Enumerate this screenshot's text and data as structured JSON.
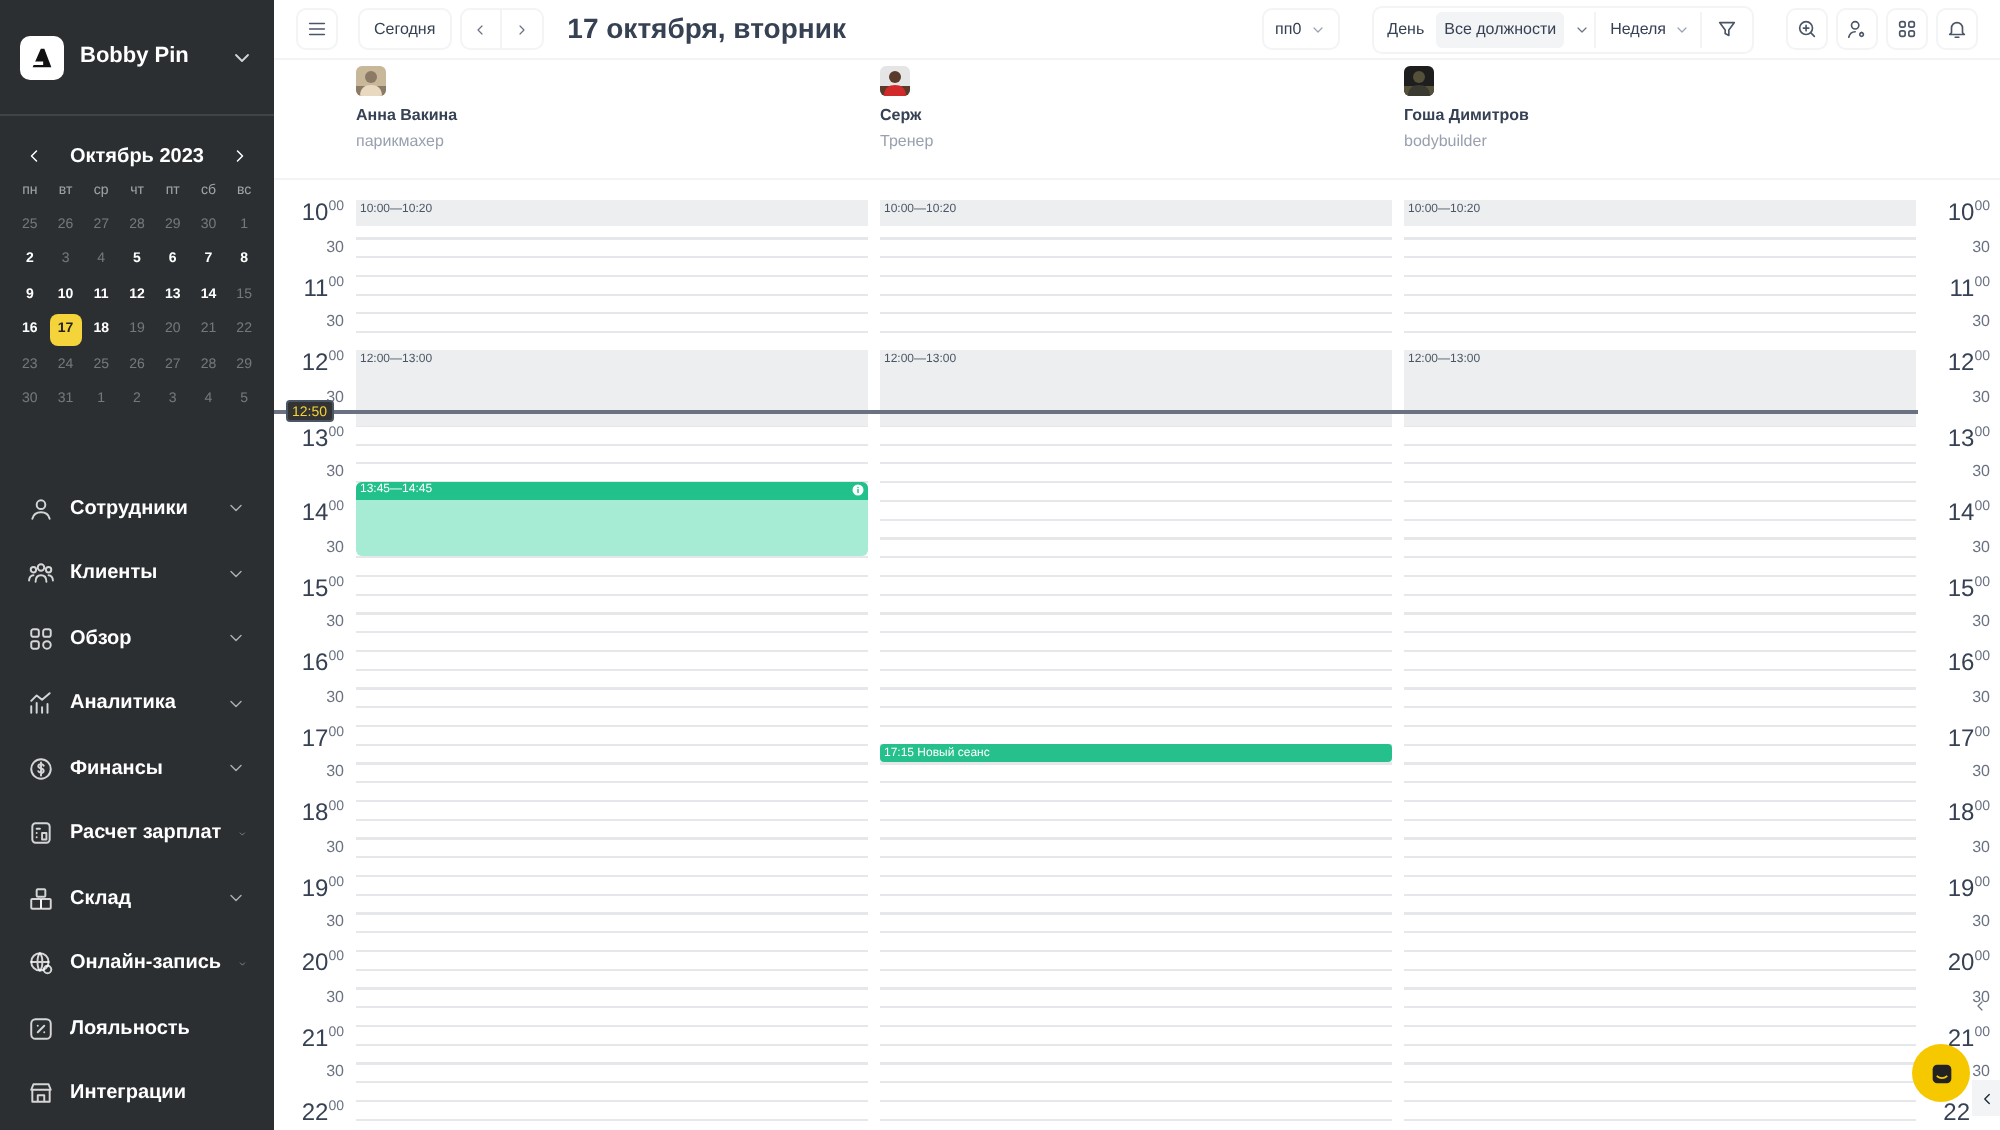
{
  "sidebar": {
    "brand": "Bobby Pin",
    "calendar": {
      "month": "Октябрь 2023",
      "weekdays": [
        "пн",
        "вт",
        "ср",
        "чт",
        "пт",
        "сб",
        "вс"
      ],
      "days": [
        {
          "label": "25",
          "selected": false,
          "has_events": false
        },
        {
          "label": "26",
          "selected": false,
          "has_events": false
        },
        {
          "label": "27",
          "selected": false,
          "has_events": false
        },
        {
          "label": "28",
          "selected": false,
          "has_events": false
        },
        {
          "label": "29",
          "selected": false,
          "has_events": false
        },
        {
          "label": "30",
          "selected": false,
          "has_events": false
        },
        {
          "label": "1",
          "selected": false,
          "has_events": false
        },
        {
          "label": "2",
          "selected": false,
          "has_events": true
        },
        {
          "label": "3",
          "selected": false,
          "has_events": false
        },
        {
          "label": "4",
          "selected": false,
          "has_events": false
        },
        {
          "label": "5",
          "selected": false,
          "has_events": true
        },
        {
          "label": "6",
          "selected": false,
          "has_events": true
        },
        {
          "label": "7",
          "selected": false,
          "has_events": true
        },
        {
          "label": "8",
          "selected": false,
          "has_events": true
        },
        {
          "label": "9",
          "selected": false,
          "has_events": true
        },
        {
          "label": "10",
          "selected": false,
          "has_events": true
        },
        {
          "label": "11",
          "selected": false,
          "has_events": true
        },
        {
          "label": "12",
          "selected": false,
          "has_events": true
        },
        {
          "label": "13",
          "selected": false,
          "has_events": true
        },
        {
          "label": "14",
          "selected": false,
          "has_events": true
        },
        {
          "label": "15",
          "selected": false,
          "has_events": false
        },
        {
          "label": "16",
          "selected": false,
          "has_events": true
        },
        {
          "label": "17",
          "selected": true,
          "has_events": true
        },
        {
          "label": "18",
          "selected": false,
          "has_events": true
        },
        {
          "label": "19",
          "selected": false,
          "has_events": false
        },
        {
          "label": "20",
          "selected": false,
          "has_events": false
        },
        {
          "label": "21",
          "selected": false,
          "has_events": false
        },
        {
          "label": "22",
          "selected": false,
          "has_events": false
        },
        {
          "label": "23",
          "selected": false,
          "has_events": false
        },
        {
          "label": "24",
          "selected": false,
          "has_events": false
        },
        {
          "label": "25",
          "selected": false,
          "has_events": false
        },
        {
          "label": "26",
          "selected": false,
          "has_events": false
        },
        {
          "label": "27",
          "selected": false,
          "has_events": false
        },
        {
          "label": "28",
          "selected": false,
          "has_events": false
        },
        {
          "label": "29",
          "selected": false,
          "has_events": false
        },
        {
          "label": "30",
          "selected": false,
          "has_events": false
        },
        {
          "label": "31",
          "selected": false,
          "has_events": false
        },
        {
          "label": "1",
          "selected": false,
          "has_events": false
        },
        {
          "label": "2",
          "selected": false,
          "has_events": false
        },
        {
          "label": "3",
          "selected": false,
          "has_events": false
        },
        {
          "label": "4",
          "selected": false,
          "has_events": false
        },
        {
          "label": "5",
          "selected": false,
          "has_events": false
        }
      ]
    },
    "menu": [
      {
        "label": "Сотрудники",
        "expandable": true
      },
      {
        "label": "Клиенты",
        "expandable": true
      },
      {
        "label": "Обзор",
        "expandable": true
      },
      {
        "label": "Аналитика",
        "expandable": true
      },
      {
        "label": "Финансы",
        "expandable": true
      },
      {
        "label": "Расчет зарплат",
        "expandable": true
      },
      {
        "label": "Склад",
        "expandable": true
      },
      {
        "label": "Онлайн-запись",
        "expandable": true
      },
      {
        "label": "Лояльность",
        "expandable": false
      },
      {
        "label": "Интеграции",
        "expandable": false
      }
    ]
  },
  "toolbar": {
    "today": "Сегодня",
    "title": "17 октября, вторник",
    "filter_select": "пп0",
    "views": [
      {
        "label": "День",
        "selected": false
      },
      {
        "label": "Все должности",
        "selected": true
      }
    ],
    "period": "Неделя"
  },
  "staff": [
    {
      "name": "Анна Вакина",
      "role": "парикмахер",
      "events": [
        {
          "kind": "break",
          "label": "10:00—10:20"
        },
        {
          "kind": "break",
          "label": "12:00—13:00"
        },
        {
          "kind": "appointment",
          "label": "13:45—14:45"
        }
      ]
    },
    {
      "name": "Серж",
      "role": "Тренер",
      "events": [
        {
          "kind": "break",
          "label": "10:00—10:20"
        },
        {
          "kind": "break",
          "label": "12:00—13:00"
        },
        {
          "kind": "session",
          "label": "17:15 Новый сеанс"
        }
      ]
    },
    {
      "name": "Гоша Димитров",
      "role": "bodybuilder",
      "events": [
        {
          "kind": "break",
          "label": "10:00—10:20"
        },
        {
          "kind": "break",
          "label": "12:00—13:00"
        }
      ]
    }
  ],
  "hours_left": [
    {
      "hour": "10",
      "minute": "00",
      "half": "30"
    },
    {
      "hour": "11",
      "minute": "00",
      "half": "30"
    },
    {
      "hour": "12",
      "minute": "00",
      "half": "30"
    },
    {
      "hour": "13",
      "minute": "00",
      "half": "30"
    },
    {
      "hour": "14",
      "minute": "00",
      "half": "30"
    },
    {
      "hour": "15",
      "minute": "00",
      "half": "30"
    },
    {
      "hour": "16",
      "minute": "00",
      "half": "30"
    },
    {
      "hour": "17",
      "minute": "00",
      "half": "30"
    },
    {
      "hour": "18",
      "minute": "00",
      "half": "30"
    },
    {
      "hour": "19",
      "minute": "00",
      "half": "30"
    },
    {
      "hour": "20",
      "minute": "00",
      "half": "30"
    },
    {
      "hour": "21",
      "minute": "00",
      "half": "30"
    },
    {
      "hour": "22",
      "minute": "00"
    }
  ],
  "hours_right": [
    {
      "hour": "10",
      "minute": "00",
      "half": "30"
    },
    {
      "hour": "11",
      "minute": "00",
      "half": "30"
    },
    {
      "hour": "12",
      "minute": "00",
      "half": "30"
    },
    {
      "hour": "13",
      "minute": "00",
      "half": "30"
    },
    {
      "hour": "14",
      "minute": "00",
      "half": "30"
    },
    {
      "hour": "15",
      "minute": "00",
      "half": "30"
    },
    {
      "hour": "16",
      "minute": "00",
      "half": "30"
    },
    {
      "hour": "17",
      "minute": "00",
      "half": "30"
    },
    {
      "hour": "18",
      "minute": "00",
      "half": "30"
    },
    {
      "hour": "19",
      "minute": "00",
      "half": "30"
    },
    {
      "hour": "20",
      "minute": "00",
      "half": "30"
    },
    {
      "hour": "21",
      "minute": "00",
      "half": "30"
    },
    {
      "hour": "22"
    }
  ],
  "now": "12:50"
}
